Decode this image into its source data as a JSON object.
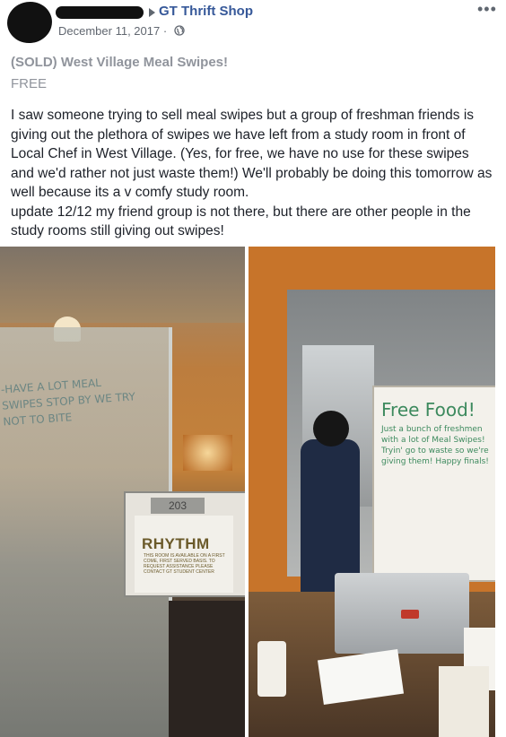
{
  "post": {
    "group_name": "GT Thrift Shop",
    "date": "December 11, 2017 ·",
    "more_options": "•••",
    "listing_title": "(SOLD) West Village Meal Swipes!",
    "price": "FREE",
    "body_paragraph_1": "I saw someone trying to sell meal swipes but a group of freshman friends is giving out the plethora of swipes we have left from a study room in front of Local Chef in West Village. (Yes, for free, we have no use for these swipes and we'd rather not just waste them!) We'll probably be doing this tomorrow as well because its a v comfy study room.",
    "body_paragraph_2": "update 12/12 my friend group is not there, but there are other people in the study rooms still giving out swipes!"
  },
  "photo_left": {
    "whiteboard_text": "-HAVE A LOT MEAL SWIPES STOP BY WE TRY NOT TO BITE",
    "room_number": "203",
    "room_name": "RHYTHM",
    "sign_fine_print": "THIS ROOM IS AVAILABLE ON A FIRST COME, FIRST SERVED BASIS. TO REQUEST ASSISTANCE PLEASE CONTACT GT STUDENT CENTER"
  },
  "photo_right": {
    "whiteboard_title": "Free Food!",
    "whiteboard_text": "Just a bunch of freshmen with a lot of Meal Swipes! Tryin' go to waste so we're giving them! Happy finals!"
  },
  "icons": [
    "globe-icon",
    "caret-right-icon",
    "more-icon"
  ],
  "colors": {
    "group_link": "#365899",
    "meta_text": "#616770",
    "title_grey": "#90949c",
    "body_text": "#1d2129"
  }
}
